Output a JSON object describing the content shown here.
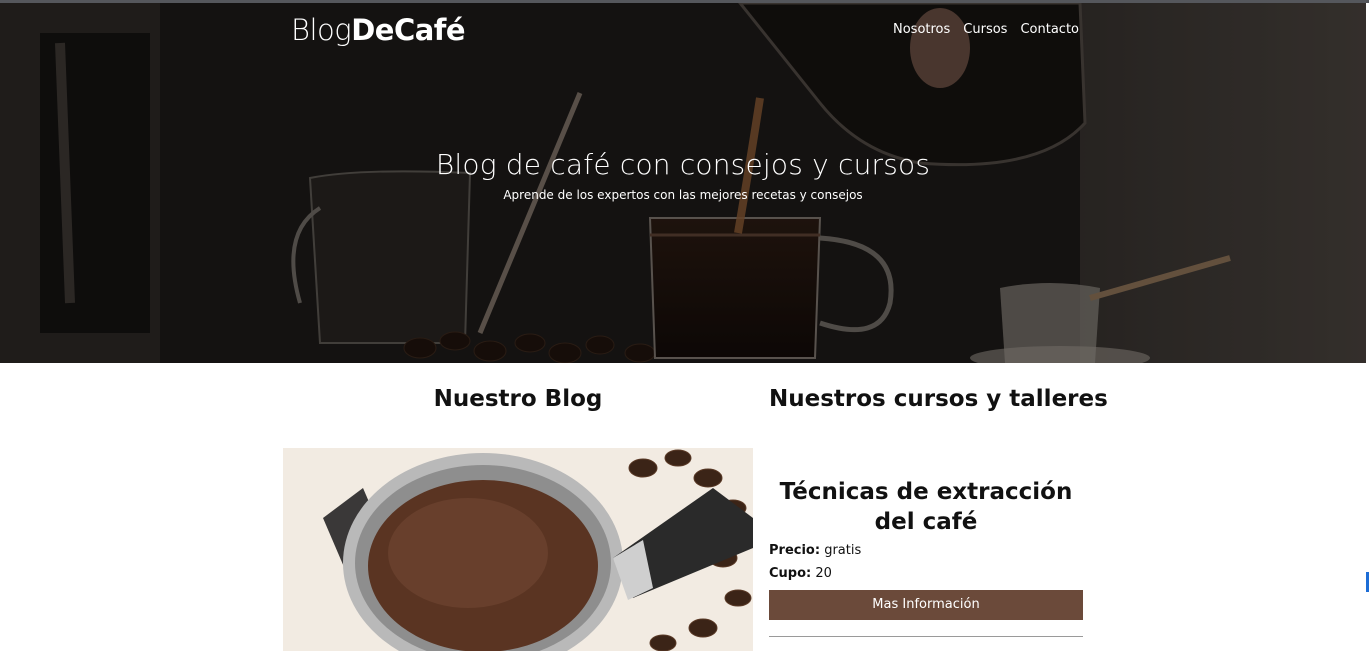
{
  "header": {
    "logo_light": "Blog",
    "logo_bold": "DeCafé",
    "nav": [
      "Nosotros",
      "Cursos",
      "Contacto"
    ]
  },
  "hero": {
    "title": "Blog de café con consejos y cursos",
    "subtitle": "Aprende de los expertos con las mejores recetas y consejos"
  },
  "blog": {
    "heading": "Nuestro Blog"
  },
  "courses": {
    "heading": "Nuestros cursos y talleres",
    "items": [
      {
        "title": "Técnicas de extracción del café",
        "price_label": "Precio:",
        "price": "gratis",
        "capacity_label": "Cupo:",
        "capacity": "20",
        "button": "Mas Información"
      }
    ]
  },
  "colors": {
    "button_bg": "#6b4a3a",
    "hero_overlay": "#1a1714"
  }
}
